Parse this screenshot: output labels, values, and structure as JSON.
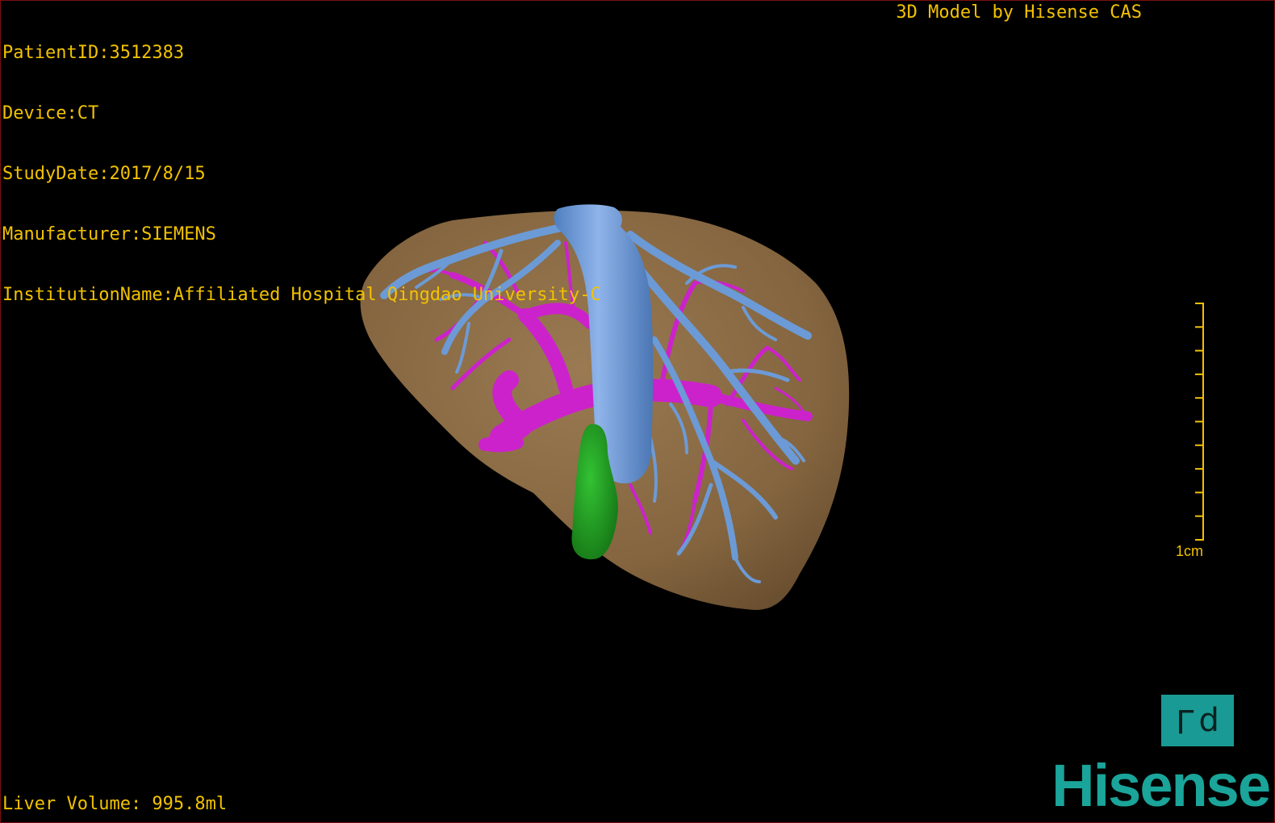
{
  "header": {
    "lines": [
      "PatientID:3512383",
      "Device:CT",
      "StudyDate:2017/8/15",
      "Manufacturer:SIEMENS",
      "InstitutionName:Affiliated Hospital Qingdao University-C"
    ],
    "model_credit": "3D Model by Hisense CAS"
  },
  "footer": {
    "liver_volume": "Liver Volume: 995.8ml"
  },
  "scale": {
    "label": "1cm",
    "ticks": 10
  },
  "orientation": {
    "left_glyph": "L",
    "right_glyph": "d"
  },
  "brand": {
    "logo_text": "Hisense"
  },
  "colors": {
    "overlay_text": "#f2c200",
    "liver": "#8a6a45",
    "hepatic_vein": "#6c9ad6",
    "portal_vein": "#cc22cc",
    "tumor": "#1f9a1f",
    "brand": "#1aa49a"
  }
}
